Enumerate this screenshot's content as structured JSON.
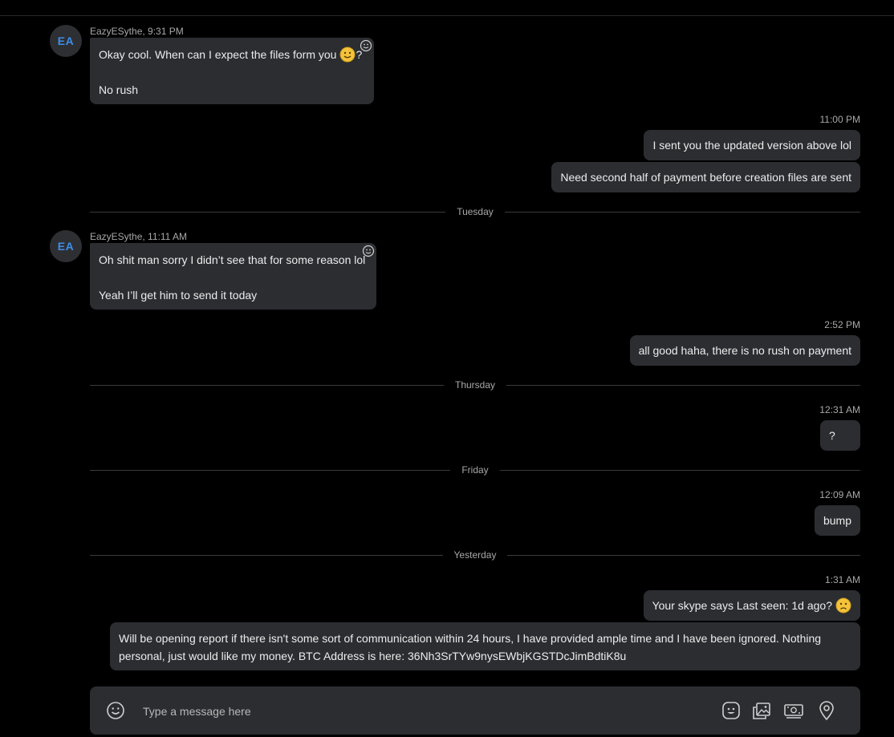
{
  "messages": {
    "m1": {
      "sender": "EazyESythe, 9:31 PM",
      "avatar": "EA",
      "line1": "Okay cool. When can I expect the files form you",
      "line1_suffix": "?",
      "line2": "No rush"
    },
    "t1": "11:00 PM",
    "m2": "I sent you the updated version above lol",
    "m3": "Need second half of payment before creation files are sent",
    "sep1": "Tuesday",
    "m4": {
      "sender": "EazyESythe, 11:11 AM",
      "avatar": "EA",
      "line1": "Oh shit man sorry I didn’t see that for some reason lol",
      "line2": "Yeah I’ll get him to send it today"
    },
    "t2": "2:52 PM",
    "m5": "all good haha, there is no rush on payment",
    "sep2": "Thursday",
    "t3": "12:31 AM",
    "m6": "?",
    "sep3": "Friday",
    "t4": "12:09 AM",
    "m7": "bump",
    "sep4": "Yesterday",
    "t5": "1:31 AM",
    "m8": "Your skype says Last seen: 1d ago?",
    "m9_line1": "Will be opening report if there isn't some sort of communication within 24 hours, I have provided ample time and I have been ignored. Nothing",
    "m9_line2": "personal, just would like my money. BTC Address is here: 36Nh3SrTYw9nysEWbjKGSTDcJimBdtiK8u"
  },
  "composer": {
    "placeholder": "Type a message here",
    "icons": [
      "emoji-icon",
      "sticker-icon",
      "media-icon",
      "money-icon",
      "location-icon"
    ]
  },
  "colors": {
    "background": "#000000",
    "bubble": "#2b2d31",
    "avatar_text": "#3d8ee8",
    "emoji_yellow": "#f5c33b"
  }
}
